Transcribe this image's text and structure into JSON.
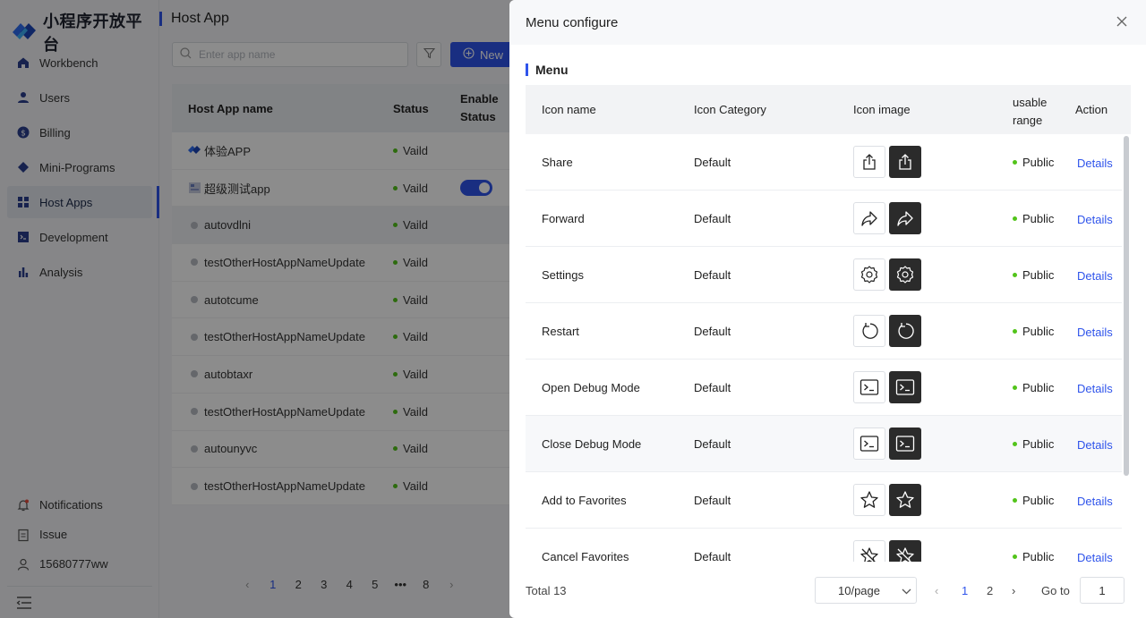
{
  "app": {
    "logo_text": "小程序开放平台",
    "page_title": "Host App"
  },
  "sidebar": {
    "items": [
      {
        "label": "Workbench",
        "icon": "home-icon"
      },
      {
        "label": "Users",
        "icon": "user-icon"
      },
      {
        "label": "Billing",
        "icon": "billing-icon"
      },
      {
        "label": "Mini-Programs",
        "icon": "diamond-icon"
      },
      {
        "label": "Host Apps",
        "icon": "grid-icon",
        "active": true
      },
      {
        "label": "Development",
        "icon": "terminal-icon"
      },
      {
        "label": "Analysis",
        "icon": "bar-chart-icon"
      }
    ],
    "bottom": [
      {
        "label": "Notifications",
        "icon": "bell-icon"
      },
      {
        "label": "Issue",
        "icon": "clipboard-icon"
      },
      {
        "label": "15680777ww",
        "icon": "account-icon"
      }
    ]
  },
  "toolbar": {
    "search_placeholder": "Enter app name",
    "new_label": "New"
  },
  "host_table": {
    "col_name": "Host App name",
    "col_status": "Status",
    "col_enable_1": "Enable",
    "col_enable_2": "Status",
    "rows": [
      {
        "name": "体验APP",
        "status": "Vaild"
      },
      {
        "name": "超级测试app",
        "status": "Vaild"
      },
      {
        "name": "autovdlni",
        "status": "Vaild"
      },
      {
        "name": "testOtherHostAppNameUpdate",
        "status": "Vaild"
      },
      {
        "name": "autotcume",
        "status": "Vaild"
      },
      {
        "name": "testOtherHostAppNameUpdate",
        "status": "Vaild"
      },
      {
        "name": "autobtaxr",
        "status": "Vaild"
      },
      {
        "name": "testOtherHostAppNameUpdate",
        "status": "Vaild"
      },
      {
        "name": "autounyvc",
        "status": "Vaild"
      },
      {
        "name": "testOtherHostAppNameUpdate",
        "status": "Vaild"
      }
    ],
    "pager": [
      "1",
      "2",
      "3",
      "4",
      "5",
      "•••",
      "8"
    ]
  },
  "drawer": {
    "title": "Menu configure",
    "section": "Menu",
    "cols": {
      "name": "Icon name",
      "category": "Icon Category",
      "image": "Icon image",
      "range_1": "usable",
      "range_2": "range",
      "action": "Action"
    },
    "rows": [
      {
        "name": "Share",
        "category": "Default",
        "icon": "share-icon",
        "range": "Public",
        "action": "Details"
      },
      {
        "name": "Forward",
        "category": "Default",
        "icon": "forward-icon",
        "range": "Public",
        "action": "Details"
      },
      {
        "name": "Settings",
        "category": "Default",
        "icon": "gear-icon",
        "range": "Public",
        "action": "Details"
      },
      {
        "name": "Restart",
        "category": "Default",
        "icon": "restart-icon",
        "range": "Public",
        "action": "Details"
      },
      {
        "name": "Open Debug Mode",
        "category": "Default",
        "icon": "terminal-icon",
        "range": "Public",
        "action": "Details"
      },
      {
        "name": "Close Debug Mode",
        "category": "Default",
        "icon": "terminal-icon",
        "range": "Public",
        "action": "Details"
      },
      {
        "name": "Add to Favorites",
        "category": "Default",
        "icon": "star-icon",
        "range": "Public",
        "action": "Details"
      },
      {
        "name": "Cancel Favorites",
        "category": "Default",
        "icon": "star-slash-icon",
        "range": "Public",
        "action": "Details"
      }
    ],
    "footer": {
      "total": "Total 13",
      "page_size": "10/page",
      "pages": [
        "1",
        "2"
      ],
      "goto_label": "Go to",
      "goto_value": "1"
    }
  }
}
